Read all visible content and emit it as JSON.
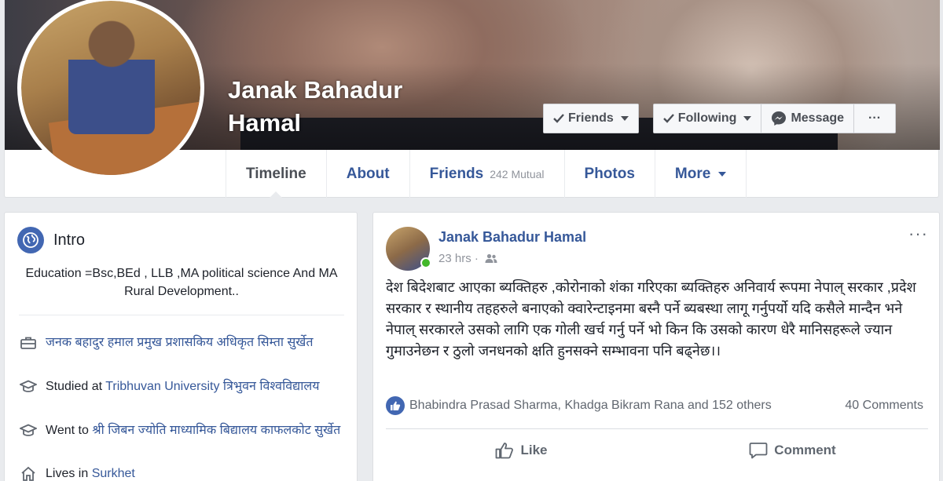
{
  "profile": {
    "name": "Janak Bahadur Hamal"
  },
  "cover_actions": {
    "friends_label": "Friends",
    "following_label": "Following",
    "message_label": "Message",
    "more_label": "···"
  },
  "tabs": [
    {
      "label": "Timeline",
      "sub": ""
    },
    {
      "label": "About",
      "sub": ""
    },
    {
      "label": "Friends",
      "sub": "242 Mutual"
    },
    {
      "label": "Photos",
      "sub": ""
    },
    {
      "label": "More",
      "sub": ""
    }
  ],
  "intro": {
    "title": "Intro",
    "bio": "Education =Bsc,BEd , LLB ,MA political science And MA Rural Development..",
    "items": [
      {
        "icon": "briefcase-icon",
        "prefix": "",
        "link": "जनक बहादुर हमाल प्रमुख प्रशासकिय अधिकृत सिम्ता सुर्खेत"
      },
      {
        "icon": "graduation-cap-icon",
        "prefix": "Studied at ",
        "link": "Tribhuvan University त्रिभुवन विश्वविद्यालय"
      },
      {
        "icon": "graduation-cap-icon",
        "prefix": "Went to ",
        "link": "श्री जिबन ज्योति माध्यामिक बिद्यालय काफलकोट सुर्खेत"
      },
      {
        "icon": "home-icon",
        "prefix": "Lives in ",
        "link": "Surkhet"
      }
    ]
  },
  "post": {
    "author": "Janak Bahadur Hamal",
    "time": "23 hrs ·",
    "audience_icon": "friends-icon",
    "menu": "···",
    "text": "देश बिदेशबाट आएका ब्यक्तिहरु ,कोरोनाको शंका गरिएका ब्यक्तिहरु अनिवार्य रूपमा नेपाल् सरकार ,प्रदेश सरकार र स्थानीय तहहरुले बनाएको क्वारेन्टाइनमा बस्नै पर्ने ब्यबस्था लागू गर्नुपर्यो यदि कसैले मान्दैन भने नेपाल् सरकारले उसको लागि एक गोली खर्च गर्नु पर्ने भो किन कि उसको कारण धेरै मानिसहरूले ज्यान गुमाउनेछन र ठुलो जनधनको क्षति हुनसक्ने सम्भावना पनि बढ्नेछ।।",
    "reactions": "Bhabindra Prasad Sharma, Khadga Bikram Rana and 152 others",
    "comments": "40 Comments",
    "like_label": "Like",
    "comment_label": "Comment"
  },
  "colors": {
    "link": "#365899",
    "brand": "#4267b2",
    "online": "#42b72a"
  }
}
